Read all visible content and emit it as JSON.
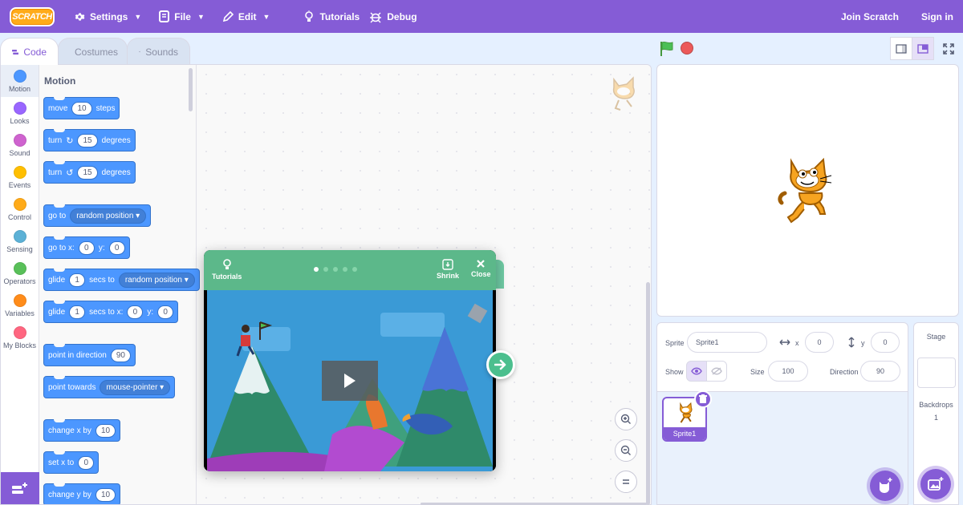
{
  "menubar": {
    "logo": "SCRATCH",
    "settings": "Settings",
    "file": "File",
    "edit": "Edit",
    "tutorials": "Tutorials",
    "debug": "Debug",
    "join": "Join Scratch",
    "signin": "Sign in",
    "color": "#855cd6"
  },
  "tabs": {
    "code": "Code",
    "costumes": "Costumes",
    "sounds": "Sounds"
  },
  "categories": [
    {
      "label": "Motion",
      "color": "#4c97ff"
    },
    {
      "label": "Looks",
      "color": "#9966ff"
    },
    {
      "label": "Sound",
      "color": "#cf63cf"
    },
    {
      "label": "Events",
      "color": "#ffbf00"
    },
    {
      "label": "Control",
      "color": "#ffab19"
    },
    {
      "label": "Sensing",
      "color": "#5cb1d6"
    },
    {
      "label": "Operators",
      "color": "#59c059"
    },
    {
      "label": "Variables",
      "color": "#ff8c1a"
    },
    {
      "label": "My Blocks",
      "color": "#ff6680"
    }
  ],
  "flyout": {
    "title": "Motion",
    "move": {
      "a": "move",
      "v": "10",
      "b": "steps"
    },
    "turn_right": {
      "a": "turn",
      "v": "15",
      "b": "degrees"
    },
    "turn_left": {
      "a": "turn",
      "v": "15",
      "b": "degrees"
    },
    "goto": {
      "a": "go to",
      "dd": "random position"
    },
    "goto_xy": {
      "a": "go to x:",
      "x": "0",
      "b": "y:",
      "y": "0"
    },
    "glide_to": {
      "a": "glide",
      "v": "1",
      "b": "secs to",
      "dd": "random position"
    },
    "glide_xy": {
      "a": "glide",
      "v": "1",
      "b": "secs to x:",
      "x": "0",
      "c": "y:",
      "y": "0"
    },
    "point_dir": {
      "a": "point in direction",
      "v": "90"
    },
    "point_towards": {
      "a": "point towards",
      "dd": "mouse-pointer"
    },
    "change_x": {
      "a": "change x by",
      "v": "10"
    },
    "set_x": {
      "a": "set x to",
      "v": "0"
    },
    "change_y": {
      "a": "change y by",
      "v": "10"
    }
  },
  "tutorial": {
    "label": "Tutorials",
    "shrink": "Shrink",
    "close": "Close",
    "total_pages": 5,
    "current_page": 1
  },
  "sprite_info": {
    "sprite_label": "Sprite",
    "sprite_name": "Sprite1",
    "x_label": "x",
    "x": "0",
    "y_label": "y",
    "y": "0",
    "show_label": "Show",
    "size_label": "Size",
    "size": "100",
    "direction_label": "Direction",
    "direction": "90"
  },
  "sprite_list": {
    "sprite_name": "Sprite1"
  },
  "stage_panel": {
    "title": "Stage",
    "backdrops_label": "Backdrops",
    "backdrops_count": "1"
  }
}
